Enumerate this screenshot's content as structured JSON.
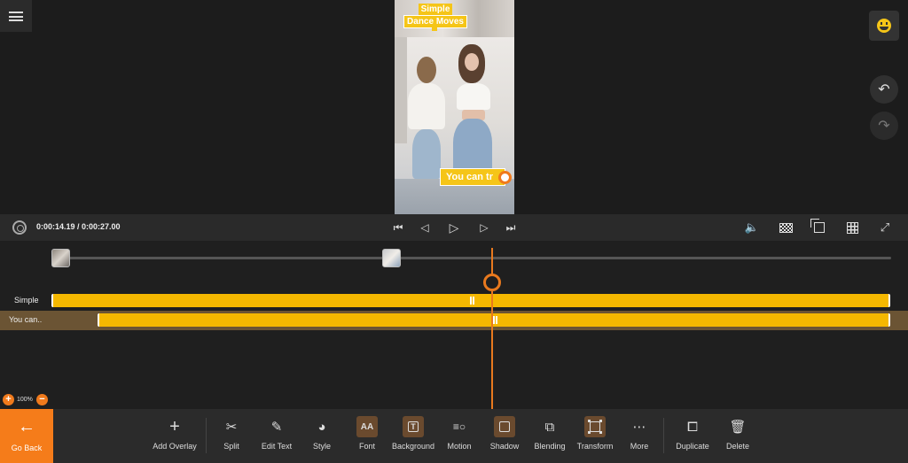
{
  "preview": {
    "caption_top_line1": "Simple",
    "caption_top_line2": "Dance Moves",
    "caption_bottom": "You can tr"
  },
  "transport": {
    "timecode": "0:00:14.19 / 0:00:27.00"
  },
  "timeline": {
    "tracks": [
      {
        "label": "Simple"
      },
      {
        "label": "You can.."
      }
    ],
    "zoom": "100%"
  },
  "toolbar": {
    "go_back": "Go Back",
    "tools": [
      {
        "label": "Add Overlay",
        "icon": "plus-icon"
      },
      {
        "label": "Split",
        "icon": "scissors-icon"
      },
      {
        "label": "Edit Text",
        "icon": "pencil-icon"
      },
      {
        "label": "Style",
        "icon": "palette-icon"
      },
      {
        "label": "Font",
        "icon": "font-icon"
      },
      {
        "label": "Background",
        "icon": "text-box-icon"
      },
      {
        "label": "Motion",
        "icon": "motion-icon"
      },
      {
        "label": "Shadow",
        "icon": "shadow-icon"
      },
      {
        "label": "Blending",
        "icon": "blending-icon"
      },
      {
        "label": "Transform",
        "icon": "transform-icon"
      },
      {
        "label": "More",
        "icon": "more-icon"
      },
      {
        "label": "Duplicate",
        "icon": "duplicate-icon"
      },
      {
        "label": "Delete",
        "icon": "trash-icon"
      }
    ]
  },
  "colors": {
    "accent": "#f57c1a",
    "track": "#f5b800",
    "selected_track_bg": "#6b5434"
  }
}
